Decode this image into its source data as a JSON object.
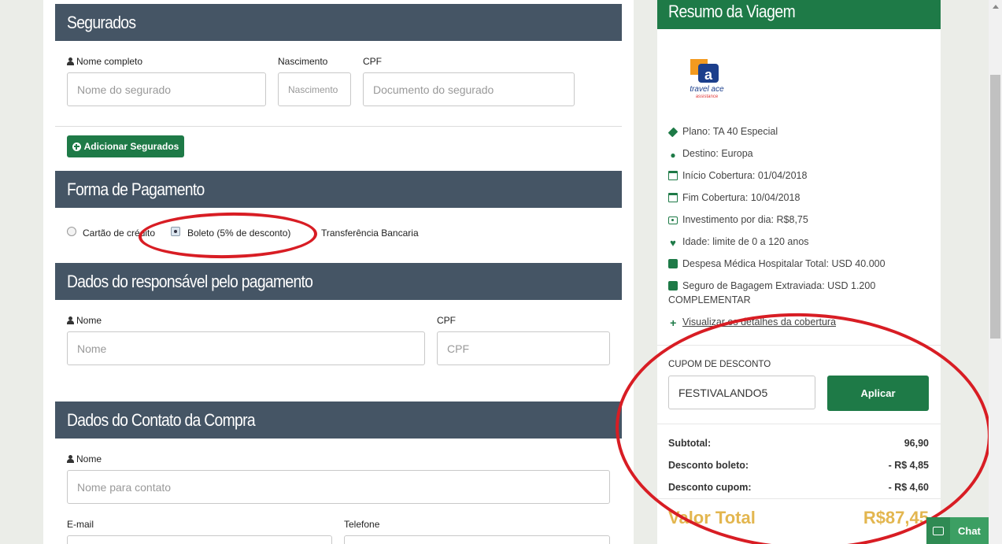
{
  "segurados": {
    "title": "Segurados",
    "nome_label": "Nome completo",
    "nome_placeholder": "Nome do segurado",
    "nascimento_label": "Nascimento",
    "nascimento_placeholder": "Nascimento",
    "cpf_label": "CPF",
    "cpf_placeholder": "Documento do segurado",
    "add_button": "Adicionar Segurados"
  },
  "pagamento": {
    "title": "Forma de Pagamento",
    "options": [
      "Cartão de crédito",
      "Boleto (5% de desconto)",
      "Transferência Bancaria"
    ],
    "selected": "Boleto (5% de desconto)"
  },
  "responsavel": {
    "title": "Dados do responsável pelo pagamento",
    "nome_label": "Nome",
    "nome_placeholder": "Nome",
    "cpf_label": "CPF",
    "cpf_placeholder": "CPF"
  },
  "contato": {
    "title": "Dados do Contato da Compra",
    "nome_label": "Nome",
    "nome_placeholder": "Nome para contato",
    "email_label": "E-mail",
    "telefone_label": "Telefone"
  },
  "resumo": {
    "title": "Resumo da Viagem",
    "logo_text": "travel ace",
    "logo_sub": "assistance",
    "plano": "Plano: TA 40 Especial",
    "destino": "Destino: Europa",
    "inicio": "Início Cobertura: 01/04/2018",
    "fim": "Fim Cobertura: 10/04/2018",
    "investimento": "Investimento por dia: R$8,75",
    "idade": "Idade: limite de 0 a 120 anos",
    "despesa": "Despesa Médica Hospitalar Total: USD 40.000",
    "bagagem_line1": "Seguro de Bagagem Extraviada: USD 1.200",
    "bagagem_line2": "COMPLEMENTAR",
    "detalhes_link": "Visualizar os detalhes da cobertura",
    "cupom_label": "CUPOM DE DESCONTO",
    "cupom_value": "FESTIVALANDO5",
    "aplicar_button": "Aplicar",
    "subtotal_label": "Subtotal:",
    "subtotal_value": "96,90",
    "desc_boleto_label": "Desconto boleto:",
    "desc_boleto_value": "- R$ 4,85",
    "desc_cupom_label": "Desconto cupom:",
    "desc_cupom_value": "- R$ 4,60",
    "total_label": "Valor Total",
    "total_value": "R$87,45"
  },
  "chat": {
    "label": "Chat"
  },
  "colors": {
    "header_dark": "#455565",
    "brand_green": "#1e7a47",
    "total_gold": "#e3b64f",
    "annotation_red": "#d81d24"
  }
}
